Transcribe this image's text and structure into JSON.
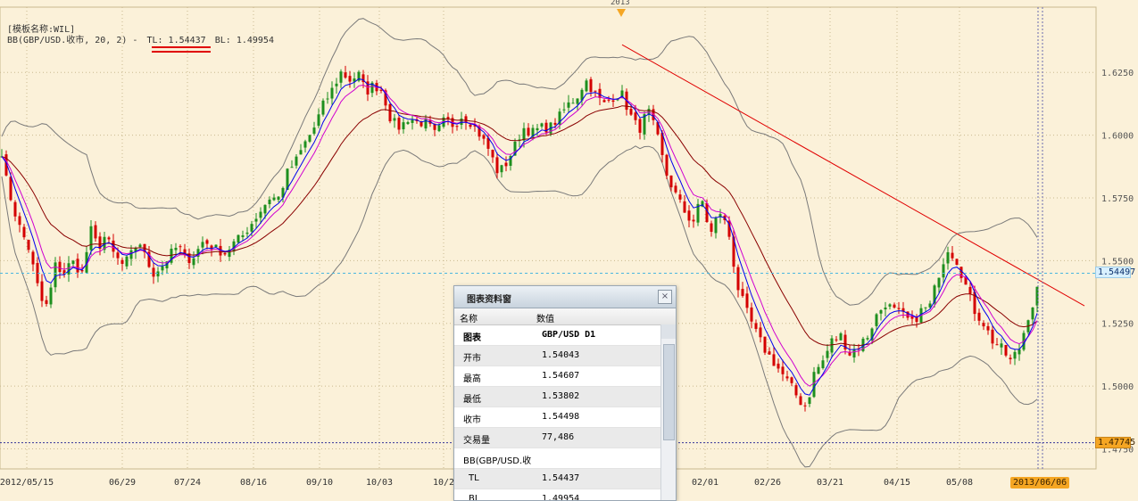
{
  "template_name": "[模板名称:WIL]",
  "bb_legend": {
    "prefix": "BB(GBP/USD.收市, 20, 2) -",
    "tl": "TL: 1.54437",
    "bl": "BL: 1.49954"
  },
  "year_marker": "2013",
  "price_labels": {
    "last": "1.54497",
    "low": "1.47745"
  },
  "current_date": "2013/06/06",
  "colors": {
    "background": "#fbf1d9",
    "bull": "#1e8f1e",
    "bear": "#d40000",
    "bb": "#7a7a7a",
    "ma_fast": "#0000ee",
    "ma_mid": "#d000d0",
    "ma_slow": "#8a0000",
    "trendline": "#e00000",
    "last_line": "#4ab6e0",
    "low_line": "#333399"
  },
  "chart_data": {
    "type": "candlestick",
    "title": "GBP/USD D1",
    "y_axis": {
      "ticks": [
        "1.6250",
        "1.6000",
        "1.5750",
        "1.5500",
        "1.5250",
        "1.5000",
        "1.4750"
      ],
      "range": [
        1.467,
        1.651
      ]
    },
    "x_axis": {
      "ticks": [
        "2012/05/15",
        "06/29",
        "07/24",
        "08/16",
        "09/10",
        "10/03",
        "10/2",
        "02/01",
        "02/26",
        "03/21",
        "04/15",
        "05/08"
      ]
    },
    "close_path": [
      [
        0,
        1.598
      ],
      [
        8,
        1.58
      ],
      [
        20,
        1.565
      ],
      [
        32,
        1.555
      ],
      [
        42,
        1.54
      ],
      [
        50,
        1.53
      ],
      [
        55,
        1.535
      ],
      [
        62,
        1.548
      ],
      [
        72,
        1.545
      ],
      [
        80,
        1.55
      ],
      [
        92,
        1.545
      ],
      [
        102,
        1.562
      ],
      [
        110,
        1.555
      ],
      [
        118,
        1.56
      ],
      [
        128,
        1.552
      ],
      [
        138,
        1.548
      ],
      [
        148,
        1.553
      ],
      [
        156,
        1.558
      ],
      [
        164,
        1.55
      ],
      [
        172,
        1.545
      ],
      [
        182,
        1.548
      ],
      [
        192,
        1.553
      ],
      [
        200,
        1.556
      ],
      [
        208,
        1.55
      ],
      [
        218,
        1.552
      ],
      [
        228,
        1.558
      ],
      [
        240,
        1.555
      ],
      [
        252,
        1.553
      ],
      [
        262,
        1.557
      ],
      [
        272,
        1.56
      ],
      [
        282,
        1.565
      ],
      [
        292,
        1.57
      ],
      [
        302,
        1.575
      ],
      [
        312,
        1.575
      ],
      [
        322,
        1.585
      ],
      [
        332,
        1.59
      ],
      [
        342,
        1.597
      ],
      [
        352,
        1.603
      ],
      [
        362,
        1.612
      ],
      [
        372,
        1.618
      ],
      [
        382,
        1.625
      ],
      [
        392,
        1.622
      ],
      [
        402,
        1.624
      ],
      [
        410,
        1.617
      ],
      [
        418,
        1.62
      ],
      [
        428,
        1.618
      ],
      [
        438,
        1.606
      ],
      [
        448,
        1.603
      ],
      [
        458,
        1.607
      ],
      [
        468,
        1.605
      ],
      [
        478,
        1.605
      ],
      [
        488,
        1.6
      ],
      [
        498,
        1.606
      ],
      [
        508,
        1.604
      ],
      [
        518,
        1.608
      ],
      [
        528,
        1.605
      ],
      [
        538,
        1.6
      ],
      [
        548,
        1.594
      ],
      [
        558,
        1.585
      ],
      [
        566,
        1.588
      ],
      [
        576,
        1.595
      ],
      [
        586,
        1.603
      ],
      [
        596,
        1.601
      ],
      [
        606,
        1.603
      ],
      [
        616,
        1.603
      ],
      [
        626,
        1.607
      ],
      [
        636,
        1.612
      ],
      [
        646,
        1.615
      ],
      [
        656,
        1.622
      ],
      [
        666,
        1.617
      ],
      [
        676,
        1.612
      ],
      [
        686,
        1.615
      ],
      [
        696,
        1.617
      ],
      [
        706,
        1.608
      ],
      [
        716,
        1.602
      ],
      [
        726,
        1.61
      ],
      [
        736,
        1.6
      ],
      [
        746,
        1.585
      ],
      [
        756,
        1.577
      ],
      [
        766,
        1.57
      ],
      [
        776,
        1.565
      ],
      [
        786,
        1.575
      ],
      [
        796,
        1.56
      ],
      [
        806,
        1.57
      ],
      [
        816,
        1.562
      ],
      [
        826,
        1.54
      ],
      [
        836,
        1.53
      ],
      [
        846,
        1.522
      ],
      [
        856,
        1.515
      ],
      [
        866,
        1.51
      ],
      [
        876,
        1.505
      ],
      [
        886,
        1.5
      ],
      [
        896,
        1.494
      ],
      [
        904,
        1.492
      ],
      [
        912,
        1.505
      ],
      [
        922,
        1.51
      ],
      [
        932,
        1.518
      ],
      [
        942,
        1.52
      ],
      [
        952,
        1.513
      ],
      [
        962,
        1.516
      ],
      [
        972,
        1.52
      ],
      [
        982,
        1.528
      ],
      [
        992,
        1.533
      ],
      [
        1002,
        1.53
      ],
      [
        1012,
        1.528
      ],
      [
        1022,
        1.525
      ],
      [
        1032,
        1.53
      ],
      [
        1042,
        1.532
      ],
      [
        1052,
        1.545
      ],
      [
        1062,
        1.555
      ],
      [
        1072,
        1.55
      ],
      [
        1082,
        1.54
      ],
      [
        1092,
        1.53
      ],
      [
        1102,
        1.525
      ],
      [
        1112,
        1.518
      ],
      [
        1122,
        1.515
      ],
      [
        1132,
        1.51
      ],
      [
        1142,
        1.515
      ],
      [
        1152,
        1.528
      ],
      [
        1160,
        1.535
      ],
      [
        1166,
        1.545
      ]
    ],
    "trendline": {
      "from": [
        697,
        1.636
      ],
      "to": [
        1215,
        1.532
      ]
    },
    "last_price": 1.54497,
    "low_level": 1.47745
  },
  "data_window": {
    "title": "图表资料窗",
    "close_glyph": "×",
    "col_name": "名称",
    "col_value": "数值",
    "rows": [
      {
        "k": "图表",
        "v": "GBP/USD D1"
      },
      {
        "k": "开市",
        "v": "1.54043"
      },
      {
        "k": "最高",
        "v": "1.54607"
      },
      {
        "k": "最低",
        "v": "1.53802"
      },
      {
        "k": "收市",
        "v": "1.54498"
      },
      {
        "k": "交易量",
        "v": "77,486"
      },
      {
        "k": "BB(GBP/USD.收",
        "v": ""
      },
      {
        "k": "TL",
        "v": "1.54437"
      },
      {
        "k": "BL",
        "v": "1.49954"
      }
    ]
  }
}
